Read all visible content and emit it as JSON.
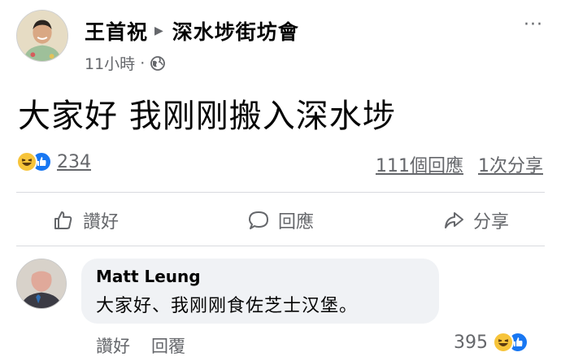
{
  "post": {
    "author": "王首祝",
    "group": "深水埗街坊會",
    "time": "11小時",
    "dot": "·",
    "body": "大家好 我刚刚搬入深水埗",
    "more": "···",
    "reaction_count": "234",
    "comments_count": "111個回應",
    "shares_count": "1次分享"
  },
  "actions": {
    "like": "讚好",
    "comment": "回應",
    "share": "分享"
  },
  "comment": {
    "author": "Matt Leung",
    "text": "大家好、我刚刚食佐芝士汉堡。",
    "like": "讚好",
    "reply": "回覆",
    "reaction_count": "395"
  },
  "colors": {
    "accent": "#1877f2",
    "haha": "#f7c43a",
    "muted": "#65676b",
    "bubble": "#f0f2f5"
  },
  "icons": {
    "more": "more-options-icon",
    "globe": "globe-icon",
    "like": "thumbs-up-icon",
    "comment": "speech-bubble-icon",
    "share": "share-arrow-icon"
  }
}
